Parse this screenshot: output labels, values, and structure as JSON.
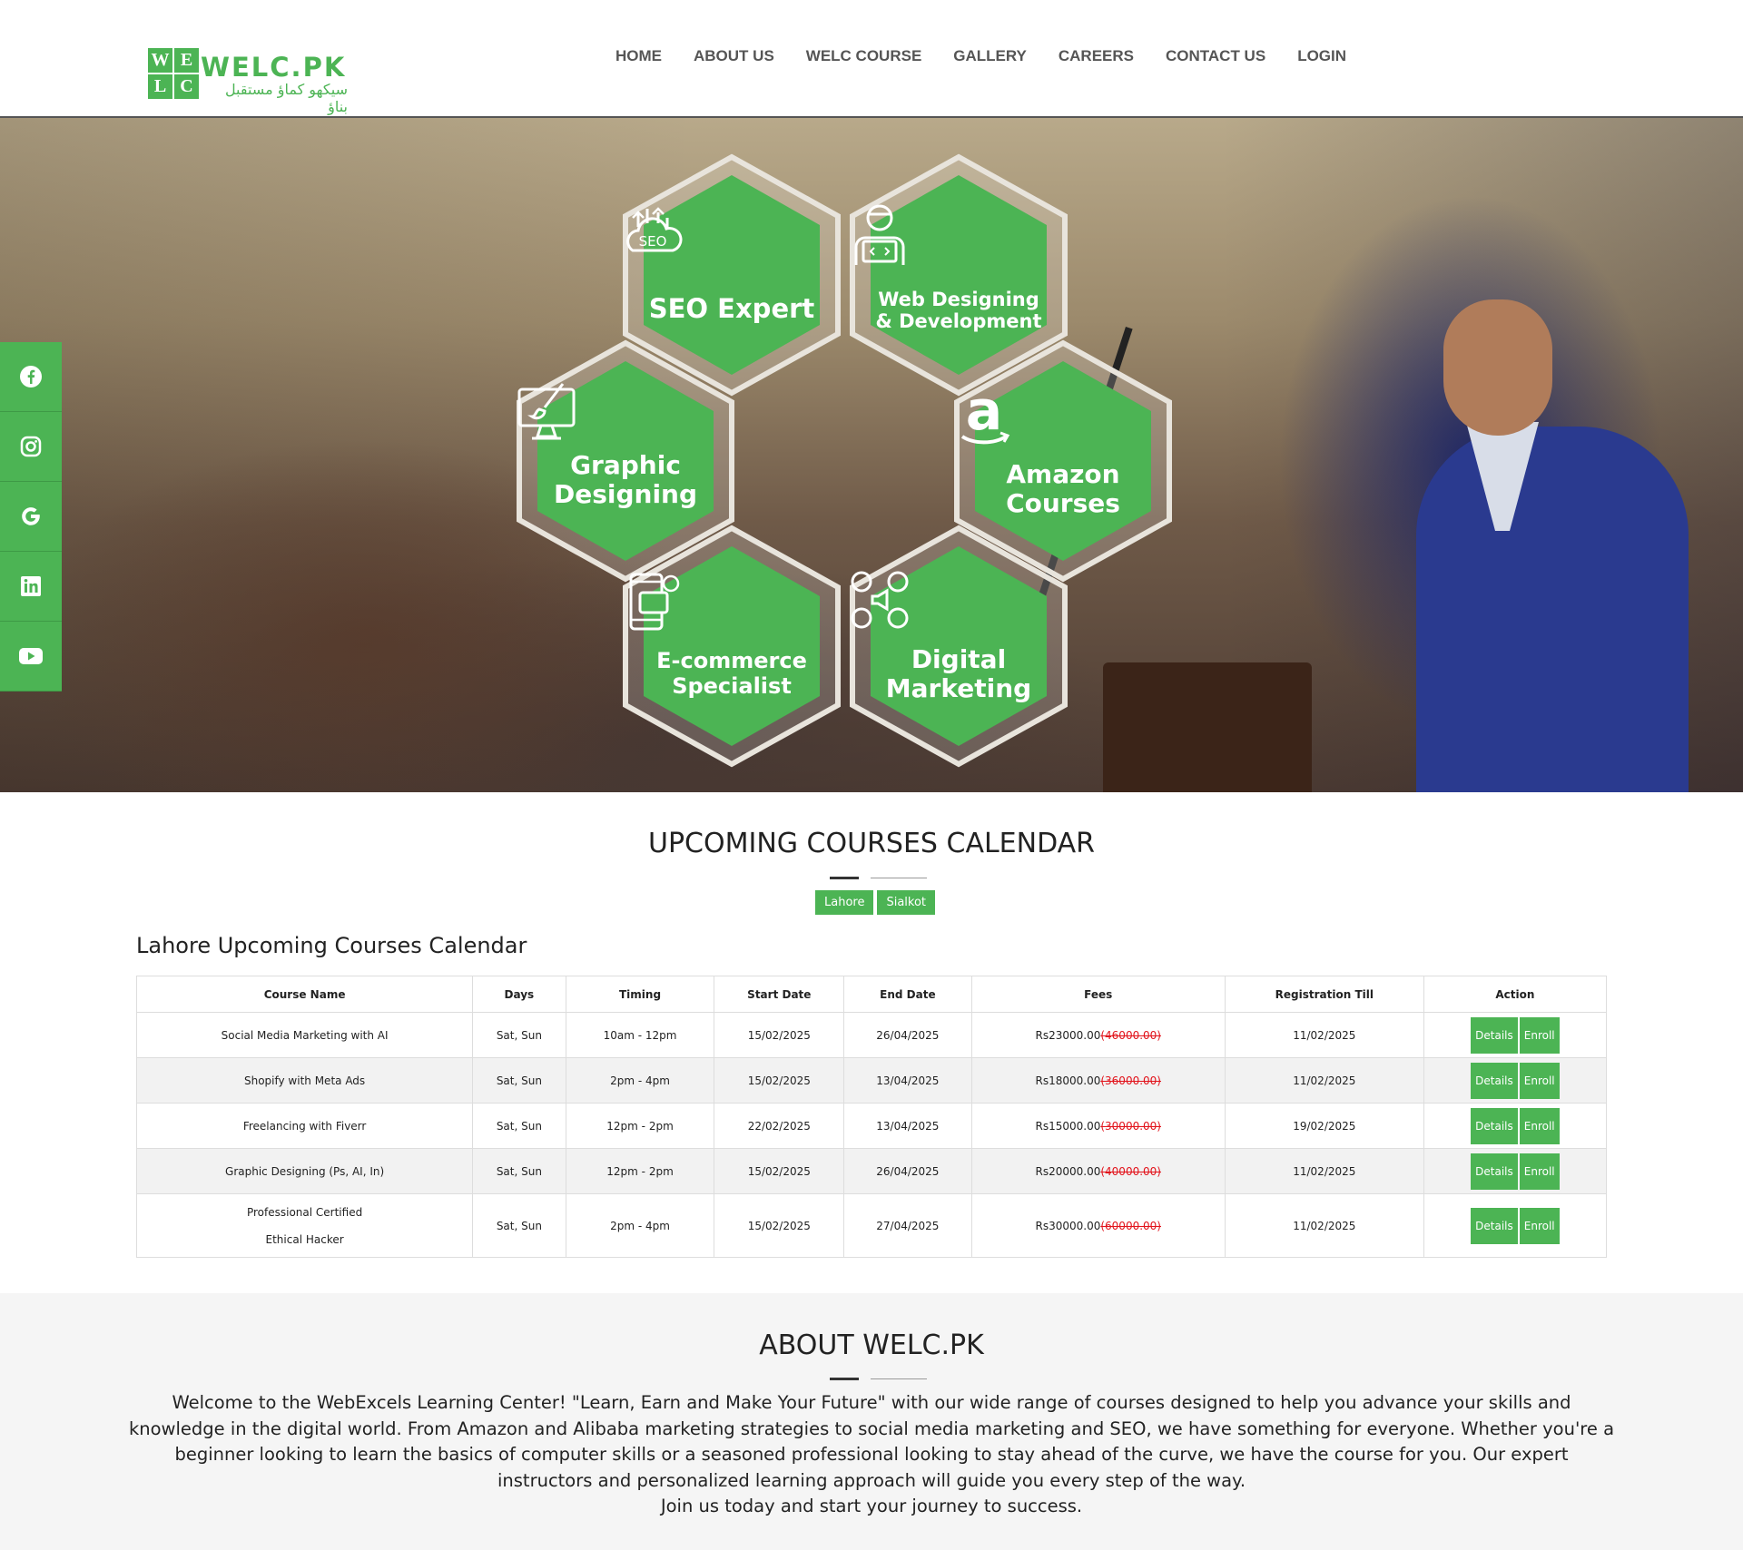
{
  "brand": {
    "logo_letters": [
      "W",
      "E",
      "L",
      "C"
    ],
    "name": "WELC.PK",
    "tagline": "سیکھو کماؤ مستقبل بناؤ",
    "accent_color": "#4cb454"
  },
  "nav": {
    "items": [
      {
        "label": "HOME"
      },
      {
        "label": "ABOUT US"
      },
      {
        "label": "WELC COURSE"
      },
      {
        "label": "GALLERY"
      },
      {
        "label": "CAREERS"
      },
      {
        "label": "CONTACT US"
      },
      {
        "label": "LOGIN"
      }
    ]
  },
  "social": [
    "facebook-icon",
    "instagram-icon",
    "google-icon",
    "linkedin-icon",
    "youtube-icon"
  ],
  "hero": {
    "hexagons": [
      {
        "icon": "seo-icon",
        "icon_text": "SEO",
        "line1": "SEO Expert",
        "line2": ""
      },
      {
        "icon": "web-developer-icon",
        "icon_text": "",
        "line1": "Web Designing",
        "line2": "& Development"
      },
      {
        "icon": "graphic-design-icon",
        "icon_text": "",
        "line1": "Graphic",
        "line2": "Designing"
      },
      {
        "icon": "amazon-icon",
        "icon_text": "a",
        "line1": "Amazon",
        "line2": "Courses"
      },
      {
        "icon": "ecommerce-icon",
        "icon_text": "",
        "line1": "E-commerce",
        "line2": "Specialist"
      },
      {
        "icon": "digital-marketing-icon",
        "icon_text": "",
        "line1": "Digital",
        "line2": "Marketing"
      }
    ]
  },
  "calendar": {
    "title": "UPCOMING COURSES CALENDAR",
    "tabs": [
      "Lahore",
      "Sialkot"
    ],
    "subtitle": "Lahore Upcoming Courses Calendar",
    "columns": [
      "Course Name",
      "Days",
      "Timing",
      "Start Date",
      "End Date",
      "Fees",
      "Registration Till",
      "Action"
    ],
    "rows": [
      {
        "name": "Social Media Marketing with AI",
        "days": "Sat, Sun",
        "timing": "10am - 12pm",
        "start": "15/02/2025",
        "end": "26/04/2025",
        "fee": "Rs23000.00",
        "fee_old": "(46000.00)",
        "reg": "11/02/2025"
      },
      {
        "name": "Shopify with Meta Ads",
        "days": "Sat, Sun",
        "timing": "2pm - 4pm",
        "start": "15/02/2025",
        "end": "13/04/2025",
        "fee": "Rs18000.00",
        "fee_old": "(36000.00)",
        "reg": "11/02/2025"
      },
      {
        "name": "Freelancing with Fiverr",
        "days": "Sat, Sun",
        "timing": "12pm - 2pm",
        "start": "22/02/2025",
        "end": "13/04/2025",
        "fee": "Rs15000.00",
        "fee_old": "(30000.00)",
        "reg": "19/02/2025"
      },
      {
        "name": "Graphic Designing (Ps, AI, In)",
        "days": "Sat, Sun",
        "timing": "12pm - 2pm",
        "start": "15/02/2025",
        "end": "26/04/2025",
        "fee": "Rs20000.00",
        "fee_old": "(40000.00)",
        "reg": "11/02/2025"
      },
      {
        "name": "Professional Certified Ethical Hacker",
        "days": "Sat, Sun",
        "timing": "2pm - 4pm",
        "start": "15/02/2025",
        "end": "27/04/2025",
        "fee": "Rs30000.00",
        "fee_old": "(60000.00)",
        "reg": "11/02/2025"
      }
    ],
    "details_label": "Details",
    "enroll_label": "Enroll"
  },
  "about": {
    "title": "ABOUT WELC.PK",
    "paragraph": "Welcome to the WebExcels Learning Center! \"Learn, Earn and Make Your Future\" with our wide range of courses designed to help you advance your skills and knowledge in the digital world. From Amazon and Alibaba marketing strategies to social media marketing and SEO, we have something for everyone. Whether you're a beginner looking to learn the basics of computer skills or a seasoned professional looking to stay ahead of the curve, we have the course for you. Our expert instructors and personalized learning approach will guide you every step of the way.",
    "closing": "Join us today and start your journey to success."
  }
}
